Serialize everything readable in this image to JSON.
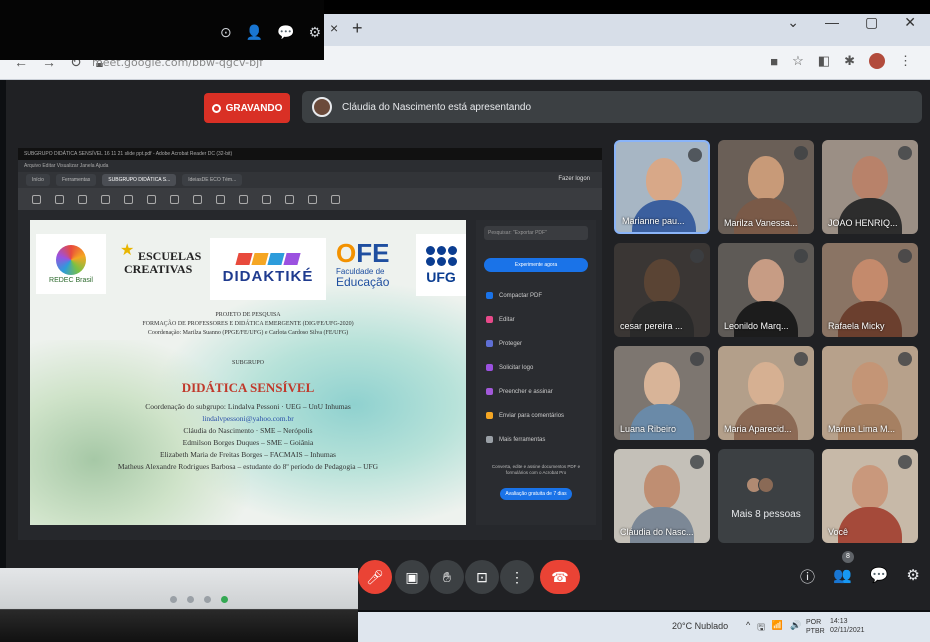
{
  "browser": {
    "new_tab_glyph": "+",
    "tab_close_glyph": "×",
    "window_controls": [
      "⌄",
      "—",
      "▢",
      "✕"
    ],
    "url": "meet.google.com/bbw-qgcv-bjf"
  },
  "meet": {
    "recording_label": "GRAVANDO",
    "presenting_text": "Cláudia do Nascimento está apresentando"
  },
  "presented_screen": {
    "window_title": "SUBGRUPO DIDÁTICA SENSÍVEL 16 11 21 slide ppt.pdf - Adobe Acrobat Reader DC (32-bit)",
    "menu": "Arquivo  Editar  Visualizar  Janela  Ajuda",
    "tabs": [
      "Início",
      "Ferramentas",
      "SUBGRUPO DIDÁTICA S...",
      "IdeiasDE ECO Tém..."
    ],
    "share_label": "Fazer logon",
    "pdf": {
      "logo_redec_label": "REDEC Brasil",
      "logo_escuelas_line1": "ESCUELAS",
      "logo_escuelas_line2": "CREATIVAS",
      "logo_didaktike": "DIDAKTIKÉ",
      "logo_fe_f": "F",
      "logo_fe_o": "O",
      "logo_fe_e": "E",
      "logo_fe_sub": "Faculdade de",
      "logo_fe_edu": "Educação",
      "logo_ufg": "UFG",
      "line_project": "PROJETO DE PESQUISA",
      "line_formacao": "FORMAÇÃO DE PROFESSORES E DIDÁTICA EMERGENTE (DIG/FE/UFG-2020)",
      "line_coord": "Coordenação: Marilza Suanno (PPGE/FE/UFG) e Carlota Cardoso Silva (FE/UFG)",
      "line_subgrupo": "SUBGRUPO",
      "title": "DIDÁTICA SENSÍVEL",
      "line_coord_sub": "Coordenação do subgrupo: Lindalva Pessoni · UEG – UnU Inhumas",
      "line_email": "lindalvpessoni@yahoo.com.br",
      "line_claudia": "Cláudia do Nascimento · SME – Nerópolis",
      "line_edmilson": "Edmilson Borges Duques – SME – Goiânia",
      "line_elizabeth": "Elizabeth Maria de Freitas Borges – FACMAIS – Inhumas",
      "line_matheus": "Matheus Alexandre Rodrigues Barbosa – estudante do 8º período de Pedagogia – UFG"
    },
    "side_panel": {
      "search_placeholder": "Pesquisar: \"Exportar PDF\"",
      "primary_button": "Experimente agora",
      "items": [
        {
          "label": "Compactar PDF",
          "color": "#1a73e8"
        },
        {
          "label": "Editar",
          "color": "#e84a8a"
        },
        {
          "label": "Proteger",
          "color": "#5f6fd4"
        },
        {
          "label": "Solicitar logo",
          "color": "#9b51e0"
        },
        {
          "label": "Preencher e assinar",
          "color": "#a259d9"
        },
        {
          "label": "Enviar para comentários",
          "color": "#f5a623"
        },
        {
          "label": "Mais ferramentas",
          "color": "#9aa0a6"
        }
      ],
      "note": "Converta, edite e assine documentos PDF e formulários com o Acrobat Pro",
      "trial_button": "Avaliação gratuita de 7 dias"
    }
  },
  "participants": [
    {
      "name": "Marianne pau...",
      "face": "#d8a888",
      "body": "#3b5f9e",
      "bg": "#a7b6c4",
      "active": true
    },
    {
      "name": "Marilza Vanessa...",
      "face": "#c89a78",
      "body": "#7a5a48",
      "bg": "#6a5f57"
    },
    {
      "name": "JOAO HENRIQ...",
      "face": "#b8826a",
      "body": "#2d2d2d",
      "bg": "#9b8f85"
    },
    {
      "name": "cesar pereira ...",
      "face": "#5a4434",
      "body": "#2a2a2a",
      "bg": "#3a3634"
    },
    {
      "name": "Leonildo Marq...",
      "face": "#c79c84",
      "body": "#1c1c1c",
      "bg": "#5e5a56"
    },
    {
      "name": "Rafaela Micky",
      "face": "#c48a6c",
      "body": "#6b3f2e",
      "bg": "#8a7464"
    },
    {
      "name": "Luana Ribeiro",
      "face": "#d8b498",
      "body": "#6a8aa8",
      "bg": "#7d7670"
    },
    {
      "name": "Maria Aparecid...",
      "face": "#d6b092",
      "body": "#8c6a55",
      "bg": "#b39f8a"
    },
    {
      "name": "Marina Lima M...",
      "face": "#c49576",
      "body": "#a68062",
      "bg": "#b7a18b"
    },
    {
      "name": "Cláudia do Nasc...",
      "face": "#bf8e72",
      "body": "#7c8896",
      "bg": "#c4c0b8"
    },
    {
      "name": "Você",
      "face": "#c9987c",
      "body": "#a54a3a",
      "bg": "#c7b9a8"
    }
  ],
  "more_people_label": "Mais 8 pessoas",
  "right_controls": [
    "ⓘ",
    "👥",
    "💬",
    "⚙"
  ],
  "people_badge": "8",
  "taskbar": {
    "weather": "20°C  Nublado",
    "tray": [
      "^",
      "🖫",
      "📶",
      "🔊"
    ],
    "lang_line1": "POR",
    "lang_line2": "PTBR",
    "time": "14:13",
    "date": "02/11/2021"
  },
  "photo_top_icons": [
    "⊙",
    "👤",
    "💬",
    "⚙"
  ]
}
